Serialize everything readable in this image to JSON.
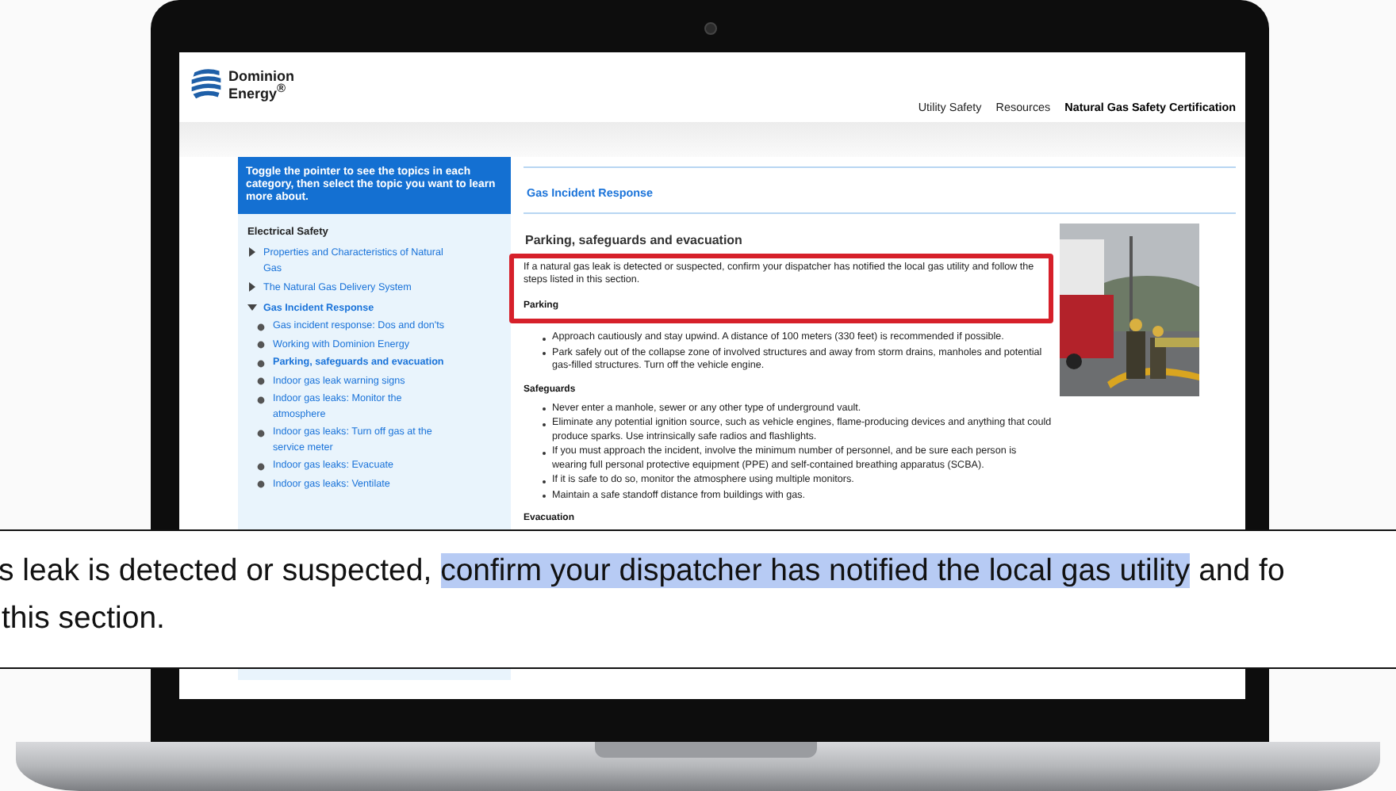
{
  "site": {
    "logo_lines": [
      "Dominion",
      "Energy$^{®}$"
    ]
  },
  "nav": [
    {
      "label": "Utility Safety",
      "selected": false
    },
    {
      "label": "Resources",
      "selected": false
    },
    {
      "label": "Natural Gas Safety Certification",
      "selected": true
    }
  ],
  "sidebar": {
    "intro": "Toggle the pointer to see the topics in each category, then select the topic you want to learn more about.",
    "section_title": "Electrical Safety",
    "items": [
      {
        "label": "Properties and Characteristics of Natural Gas",
        "expanded": false
      },
      {
        "label": "The Natural Gas Delivery System",
        "expanded": false
      },
      {
        "label": "Gas Incident Response",
        "expanded": true,
        "children": [
          {
            "label": "Gas incident response: Dos and don'ts",
            "selected": false
          },
          {
            "label": "Working with Dominion Energy",
            "selected": false
          },
          {
            "label": "Parking, safeguards and evacuation",
            "selected": true
          },
          {
            "label": "Indoor gas leak warning signs",
            "selected": false
          },
          {
            "label": "Indoor gas leaks: Monitor the atmosphere",
            "selected": false
          },
          {
            "label": "Indoor gas leaks: Turn off gas at the service meter",
            "selected": false
          },
          {
            "label": "Indoor gas leaks: Evacuate",
            "selected": false
          },
          {
            "label": "Indoor gas leaks: Ventilate",
            "selected": false
          }
        ]
      }
    ]
  },
  "content": {
    "section_title": "Gas Incident Response",
    "heading": "Parking, safeguards and evacuation",
    "intro": "If a natural gas leak is detected or suspected, confirm your dispatcher has notified the local gas utility and follow the steps listed in this section.",
    "groups": [
      {
        "title": "Parking",
        "bullets": [
          "Approach cautiously and stay upwind. A distance of 100 meters (330 feet) is recommended if possible.",
          "Park safely out of the collapse zone of involved structures and away from storm drains, manholes and potential gas-filled structures. Turn off the vehicle engine."
        ]
      },
      {
        "title": "Safeguards",
        "bullets": [
          "Never enter a manhole, sewer or any other type of underground vault.",
          "Eliminate any potential ignition source, such as vehicle engines, flame-producing devices and anything that could produce sparks. Use intrinsically safe radios and flashlights.",
          "If you must approach the incident, involve the minimum number of personnel, and be sure each person is wearing full personal protective equipment (PPE) and self-contained breathing apparatus (SCBA).",
          "If it is safe to do so, monitor the atmosphere using multiple monitors.",
          "Maintain a safe standoff distance from buildings with gas."
        ]
      },
      {
        "title": "Evacuation"
      }
    ]
  },
  "callout": {
    "lines": [
      {
        "before": "s leak is detected or suspected, ",
        "highlighted": "confirm your dispatcher has notified the local gas utility",
        "after": " and fo"
      },
      {
        "before": "this section."
      }
    ]
  }
}
